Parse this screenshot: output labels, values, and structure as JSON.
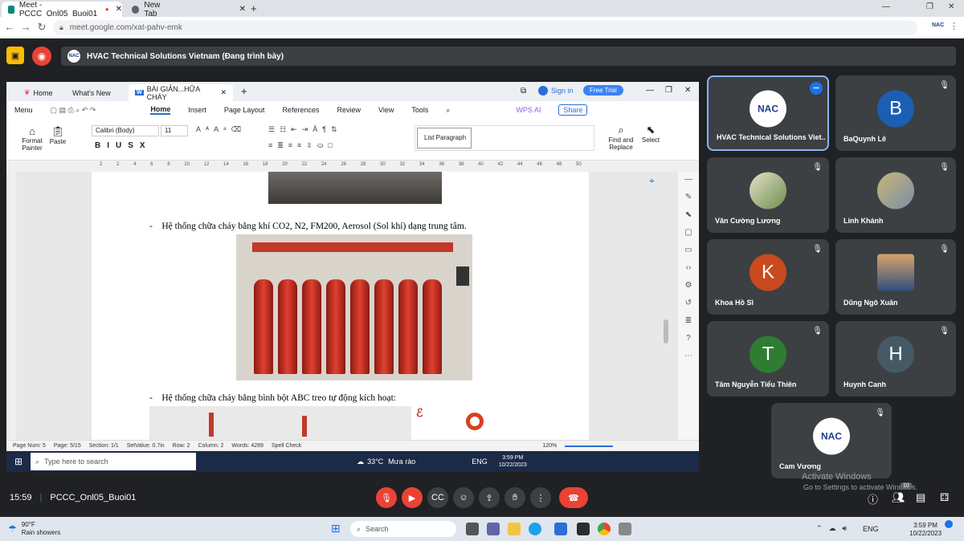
{
  "browser": {
    "tabs": [
      {
        "label": "Meet - PCCC_Onl05_Buoi01",
        "active": true
      },
      {
        "label": "New Tab",
        "active": false
      }
    ],
    "url": "meet.google.com/xat-pahv-emk",
    "ext_label": "NAC"
  },
  "meet": {
    "presenter_logo": "NAC",
    "presenter_text": "HVAC Technical Solutions Vietnam (Đang trình bày)",
    "time": "15:59",
    "meeting_code": "PCCC_Onl05_Buoi01",
    "participant_count": "10",
    "watermark_line1": "Activate Windows",
    "watermark_line2": "Go to Settings to activate Windows."
  },
  "participants": [
    {
      "name": "HVAC Technical Solutions Viet...",
      "avatar": "NAC",
      "type": "logo"
    },
    {
      "name": "BaQuynh Lê",
      "avatar": "B",
      "color": "#1a5fb4",
      "type": "letter"
    },
    {
      "name": "Văn Cường Lương",
      "avatar": "photo",
      "type": "photo"
    },
    {
      "name": "Linh Khánh",
      "avatar": "photo",
      "type": "photo"
    },
    {
      "name": "Khoa Hồ Sĩ",
      "avatar": "K",
      "color": "#c94a1f",
      "type": "letter"
    },
    {
      "name": "Dũng Ngô Xuân",
      "avatar": "photo",
      "type": "photo"
    },
    {
      "name": "Tâm Nguyễn Tiểu Thiên",
      "avatar": "T",
      "color": "#2e7d32",
      "type": "letter"
    },
    {
      "name": "Huynh Canh",
      "avatar": "H",
      "color": "#455a64",
      "type": "letter"
    },
    {
      "name": "Cam Vương",
      "avatar": "NAC",
      "type": "logo"
    }
  ],
  "wps": {
    "tabs": [
      "Home",
      "What's New",
      "BÀI GIẢN...HỮA CHÁY"
    ],
    "sign_in": "Sign in",
    "free_trial": "Free Trial",
    "menu": [
      "Menu",
      "Home",
      "Insert",
      "Page Layout",
      "References",
      "Review",
      "View",
      "Tools"
    ],
    "wps_ai": "WPS AI",
    "share": "Share",
    "ribbon": {
      "format_painter": "Format Painter",
      "paste": "Paste",
      "font": "Calibri (Body)",
      "size": "11",
      "style": "List Paragraph",
      "find_replace": "Find and Replace",
      "select": "Select"
    },
    "ruler_ticks": [
      "2",
      "2",
      "4",
      "6",
      "8",
      "10",
      "12",
      "14",
      "16",
      "18",
      "20",
      "22",
      "24",
      "26",
      "28",
      "30",
      "32",
      "34",
      "36",
      "38",
      "40",
      "42",
      "44",
      "46",
      "48",
      "50"
    ],
    "doc": {
      "bullet1": "Hệ thống chữa cháy bằng khí CO2, N2, FM200, Aerosol (Sol khí) dạng trung tâm.",
      "bullet2": "Hệ thống chữa cháy bằng bình bột ABC treo tự động kích hoạt:"
    },
    "status": {
      "page_num": "Page Num: 5",
      "page": "Page: 5/15",
      "section": "Section: 1/1",
      "setvalue": "SetValue: 0.7in",
      "row": "Row: 2",
      "column": "Column: 2",
      "words": "Words: 4289",
      "spell": "Spell Check",
      "zoom": "120%"
    },
    "taskbar": {
      "search": "Type here to search",
      "weather": "33°C",
      "weather_text": "Mưa rào",
      "lang": "ENG",
      "time": "3:59 PM",
      "date": "10/22/2023"
    }
  },
  "windows": {
    "temp": "90°F",
    "weather": "Rain showers",
    "search": "Search",
    "lang": "ENG",
    "time": "3:59 PM",
    "date": "10/22/2023"
  }
}
